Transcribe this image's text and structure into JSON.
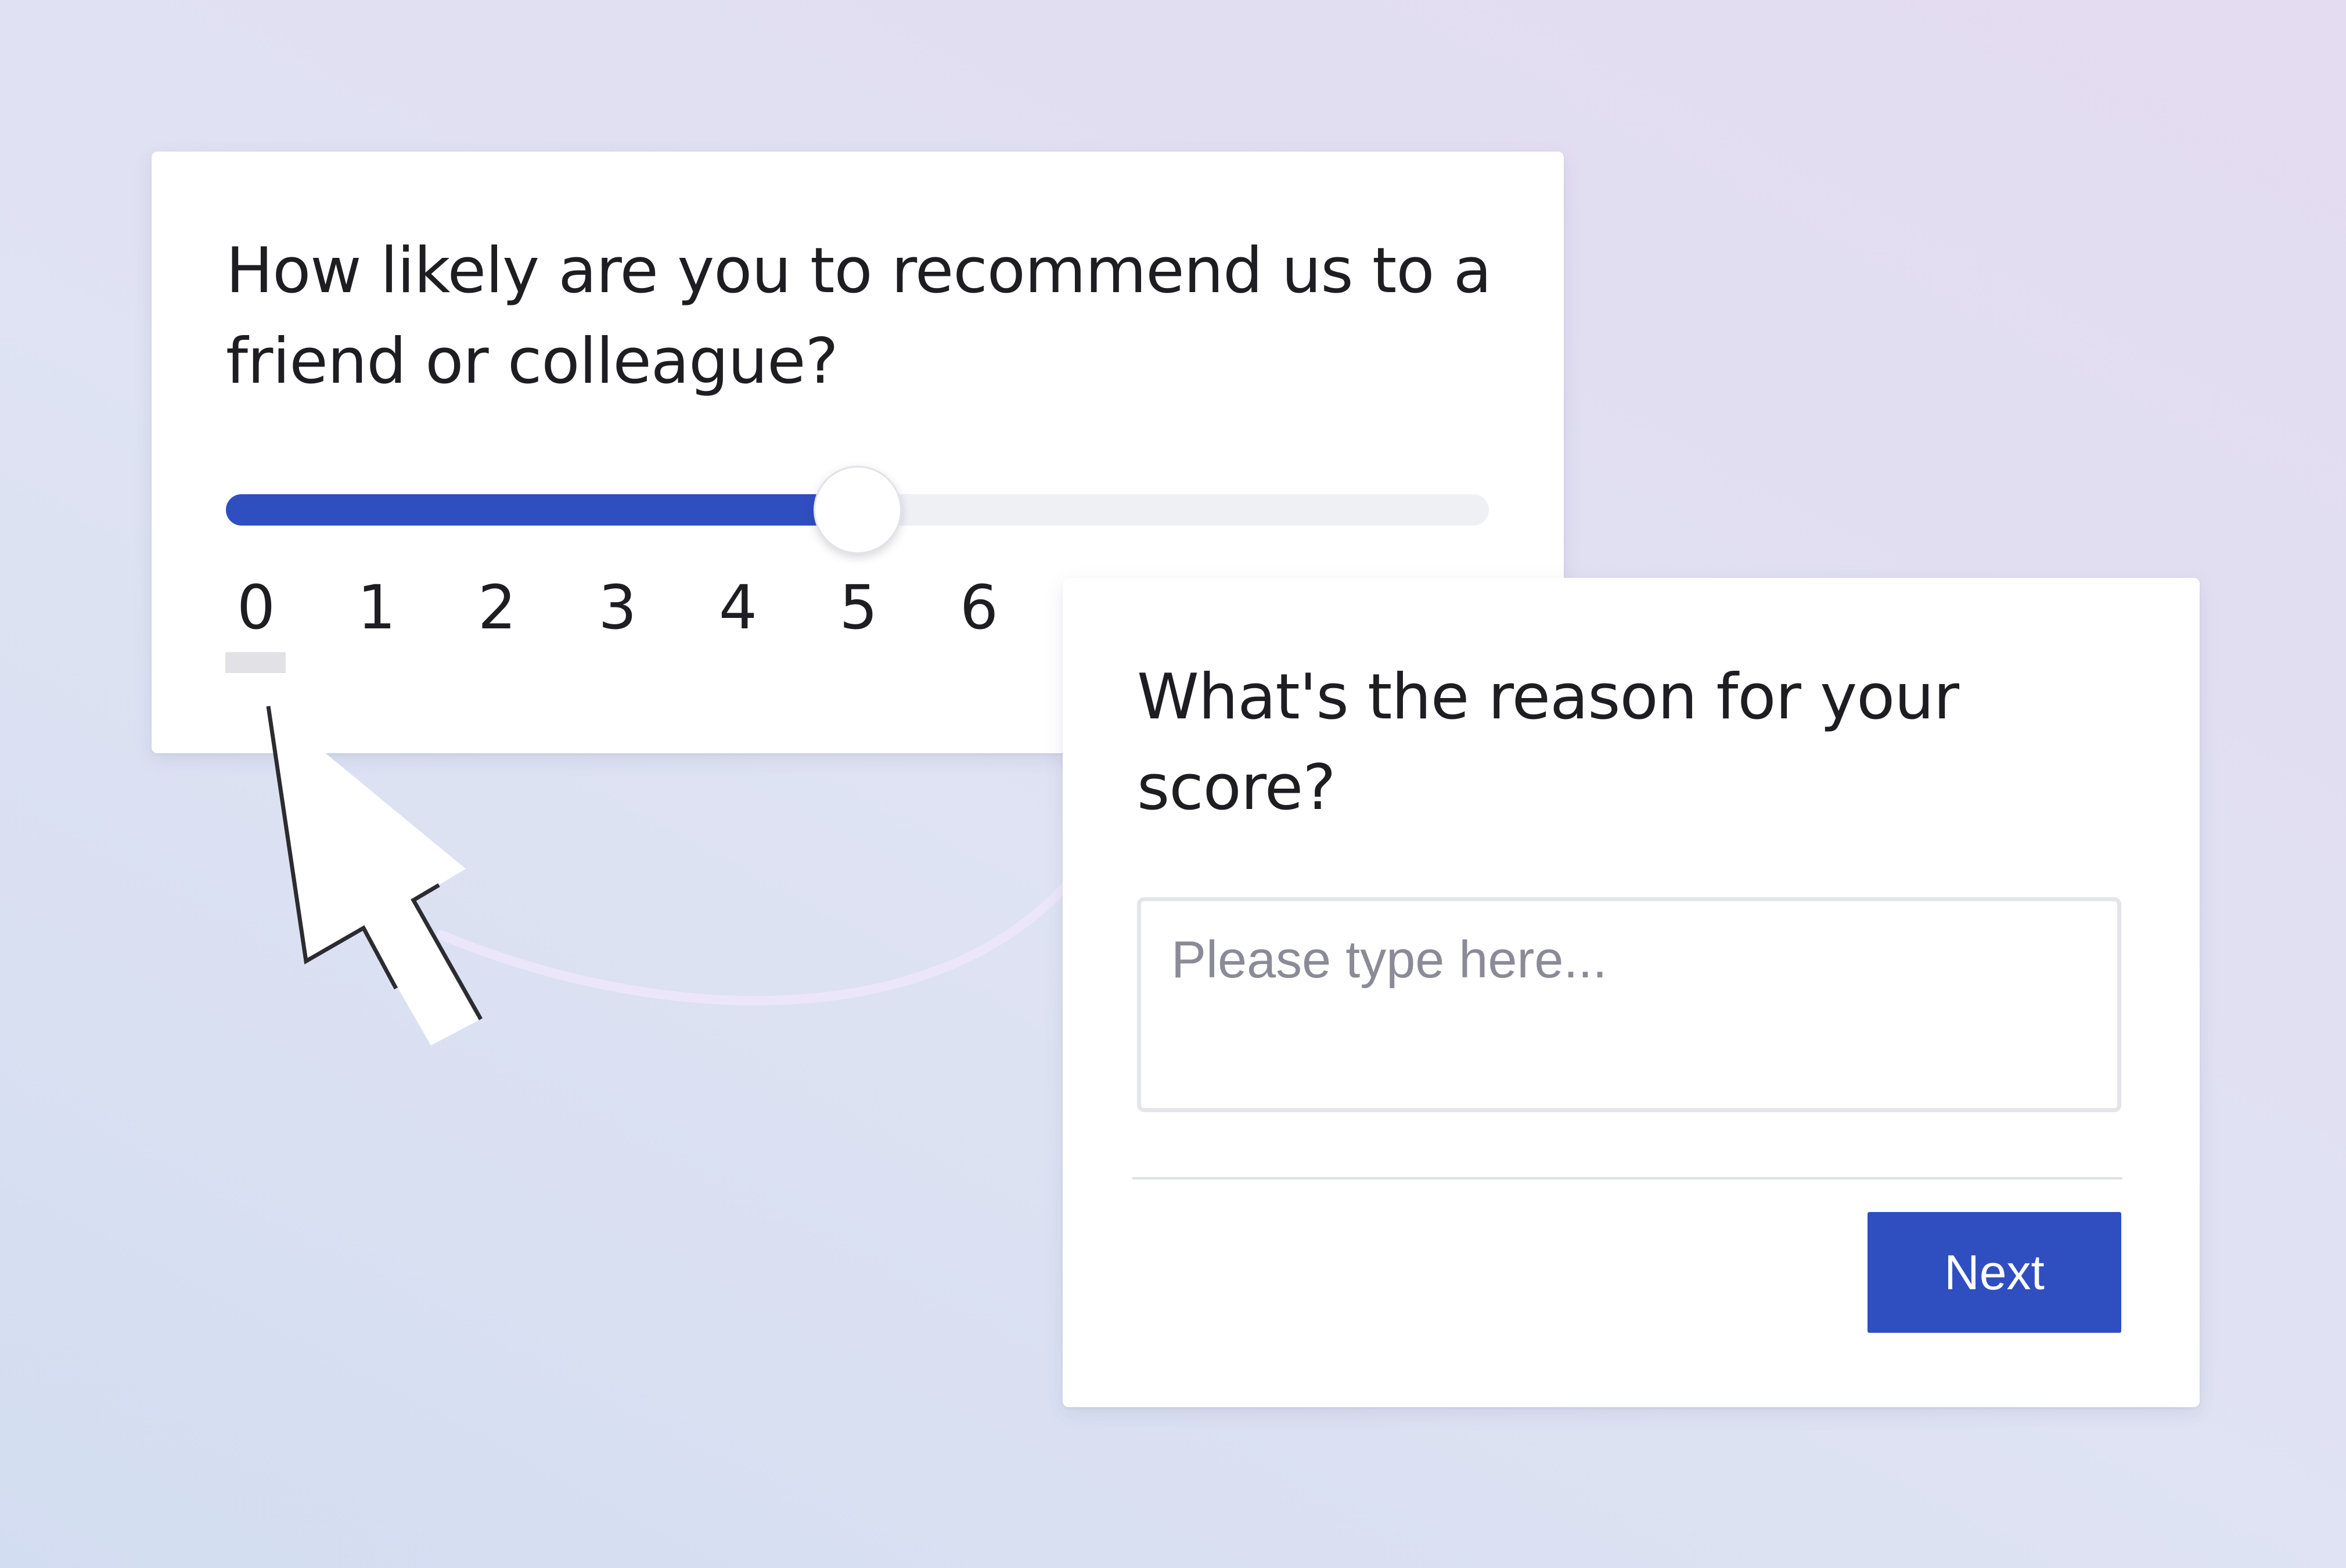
{
  "nps_card": {
    "question": "How likely are you to recommend us to a friend or colleague?",
    "slider": {
      "value": 5,
      "min": 0,
      "max": 10,
      "visible_labels": [
        "0",
        "1",
        "2",
        "3",
        "4",
        "5",
        "6"
      ]
    }
  },
  "reason_card": {
    "question": "What's the reason for your score?",
    "input": {
      "value": "",
      "placeholder": "Please type here..."
    },
    "next_label": "Next"
  },
  "colors": {
    "accent": "#2f4fc0",
    "track": "#eff0f4",
    "text": "#1d1d22",
    "placeholder": "#8a8b97"
  },
  "icons": {
    "pointer": "mouse-pointer-cursor-icon"
  }
}
